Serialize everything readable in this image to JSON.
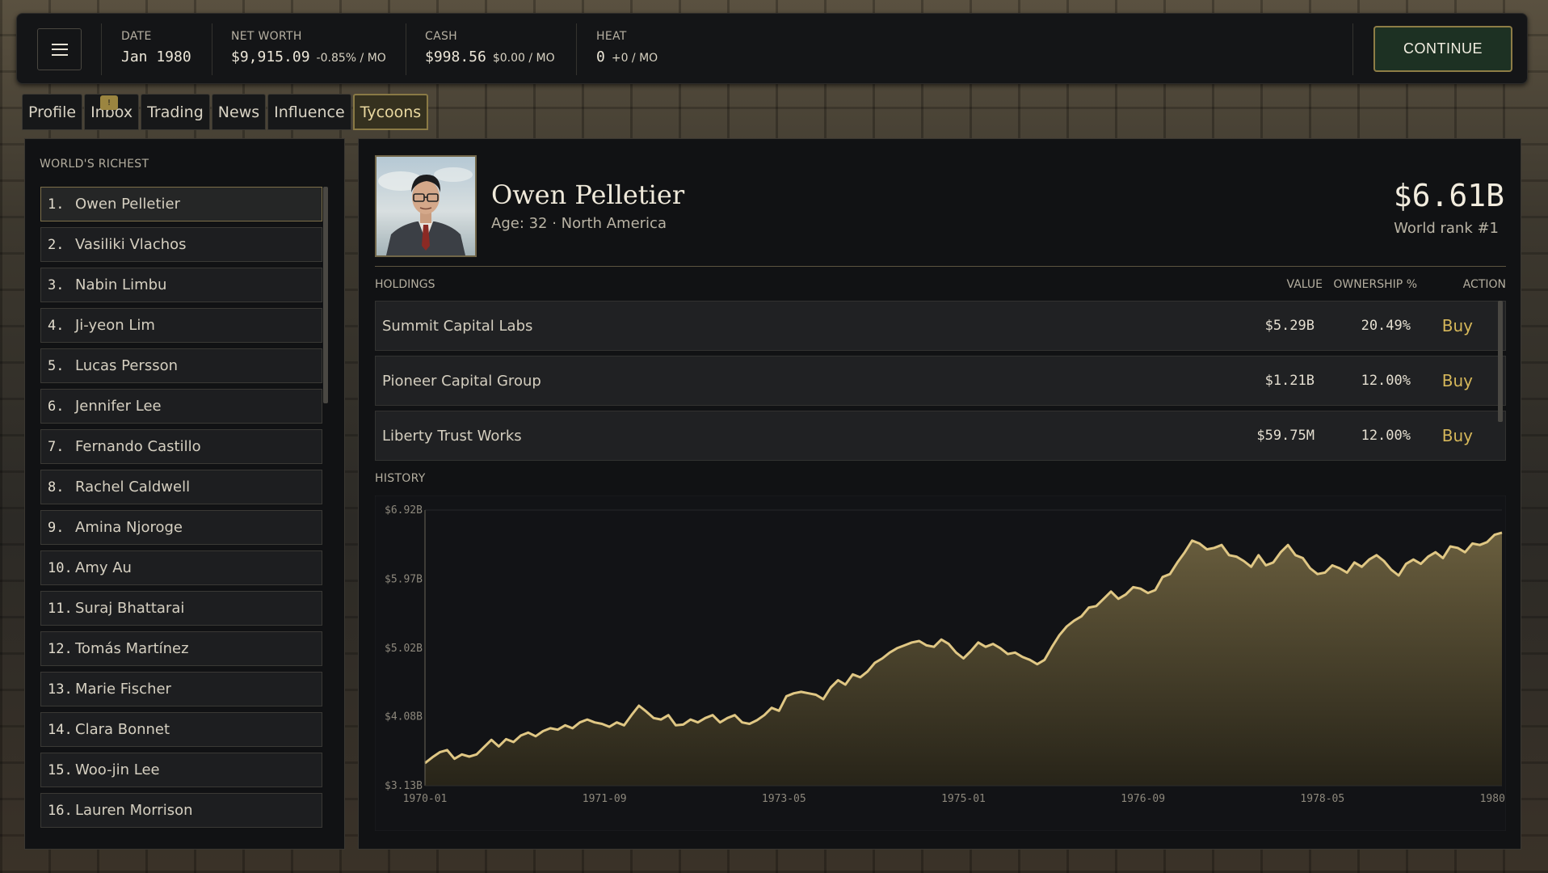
{
  "topbar": {
    "date": {
      "label": "DATE",
      "value": "Jan 1980"
    },
    "net_worth": {
      "label": "NET WORTH",
      "value": "$9,915.09",
      "delta": "-0.85% / MO"
    },
    "cash": {
      "label": "CASH",
      "value": "$998.56",
      "delta": "$0.00 / MO"
    },
    "heat": {
      "label": "HEAT",
      "value": "0",
      "delta": "+0 / MO"
    },
    "continue_label": "CONTINUE"
  },
  "tabs": [
    {
      "label": "Profile"
    },
    {
      "label": "Inbox"
    },
    {
      "label": "Trading"
    },
    {
      "label": "News"
    },
    {
      "label": "Influence"
    },
    {
      "label": "Tycoons"
    }
  ],
  "inbox_badge": "!",
  "richest": {
    "heading": "WORLD'S RICHEST",
    "items": [
      {
        "rank": "1.",
        "name": "Owen Pelletier"
      },
      {
        "rank": "2.",
        "name": "Vasiliki Vlachos"
      },
      {
        "rank": "3.",
        "name": "Nabin Limbu"
      },
      {
        "rank": "4.",
        "name": "Ji-yeon Lim"
      },
      {
        "rank": "5.",
        "name": "Lucas Persson"
      },
      {
        "rank": "6.",
        "name": "Jennifer Lee"
      },
      {
        "rank": "7.",
        "name": "Fernando Castillo"
      },
      {
        "rank": "8.",
        "name": "Rachel Caldwell"
      },
      {
        "rank": "9.",
        "name": "Amina Njoroge"
      },
      {
        "rank": "10.",
        "name": "Amy Au"
      },
      {
        "rank": "11.",
        "name": "Suraj Bhattarai"
      },
      {
        "rank": "12.",
        "name": "Tomás Martínez"
      },
      {
        "rank": "13.",
        "name": "Marie Fischer"
      },
      {
        "rank": "14.",
        "name": "Clara Bonnet"
      },
      {
        "rank": "15.",
        "name": "Woo-jin Lee"
      },
      {
        "rank": "16.",
        "name": "Lauren Morrison"
      }
    ]
  },
  "profile": {
    "name": "Owen Pelletier",
    "subtitle": "Age: 32 · North America",
    "net_worth": "$6.61B",
    "world_rank": "World rank #1"
  },
  "holdings": {
    "heading": "HOLDINGS",
    "col_value": "VALUE",
    "col_ownership": "OWNERSHIP %",
    "col_action": "ACTION",
    "rows": [
      {
        "name": "Summit Capital Labs",
        "value": "$5.29B",
        "ownership": "20.49%",
        "action": "Buy"
      },
      {
        "name": "Pioneer Capital Group",
        "value": "$1.21B",
        "ownership": "12.00%",
        "action": "Buy"
      },
      {
        "name": "Liberty Trust Works",
        "value": "$59.75M",
        "ownership": "12.00%",
        "action": "Buy"
      }
    ]
  },
  "history_heading": "HISTORY",
  "colors": {
    "accent_gold": "#d5b75a",
    "area_fill_top": "#6e6240",
    "line": "#e0c784",
    "continue_bg": "#1d3123"
  },
  "chart_data": {
    "type": "area",
    "title": "",
    "xlabel": "",
    "ylabel": "",
    "y_tick_labels": [
      "$6.92B",
      "$5.97B",
      "$5.02B",
      "$4.08B",
      "$3.13B"
    ],
    "y_ticks": [
      6.92,
      5.97,
      5.02,
      4.08,
      3.13
    ],
    "x_tick_labels": [
      "1970-01",
      "1971-09",
      "1973-05",
      "1975-01",
      "1976-09",
      "1978-05",
      "1980-01"
    ],
    "ylim": [
      3.13,
      6.92
    ],
    "grid": false,
    "series": [
      {
        "values": [
          3.44,
          3.52,
          3.59,
          3.62,
          3.5,
          3.56,
          3.53,
          3.56,
          3.66,
          3.76,
          3.67,
          3.77,
          3.73,
          3.82,
          3.86,
          3.81,
          3.88,
          3.92,
          3.9,
          3.96,
          3.92,
          4.0,
          4.04,
          4.0,
          3.98,
          3.94,
          4.0,
          3.96,
          4.1,
          4.23,
          4.15,
          4.06,
          4.04,
          4.1,
          3.96,
          3.97,
          4.04,
          4.0,
          4.06,
          4.1,
          4.0,
          4.06,
          4.1,
          4.0,
          3.98,
          4.03,
          4.1,
          4.2,
          4.16,
          4.36,
          4.4,
          4.42,
          4.4,
          4.38,
          4.32,
          4.48,
          4.58,
          4.52,
          4.66,
          4.62,
          4.7,
          4.82,
          4.88,
          4.96,
          5.02,
          5.06,
          5.1,
          5.12,
          5.06,
          5.04,
          5.14,
          5.08,
          4.96,
          4.88,
          4.98,
          5.1,
          5.04,
          5.08,
          5.02,
          4.94,
          4.96,
          4.9,
          4.86,
          4.8,
          4.86,
          5.04,
          5.2,
          5.32,
          5.4,
          5.46,
          5.58,
          5.6,
          5.7,
          5.8,
          5.7,
          5.76,
          5.86,
          5.84,
          5.78,
          5.82,
          6.0,
          6.04,
          6.2,
          6.34,
          6.5,
          6.46,
          6.38,
          6.4,
          6.44,
          6.3,
          6.28,
          6.22,
          6.14,
          6.3,
          6.16,
          6.2,
          6.34,
          6.44,
          6.3,
          6.26,
          6.12,
          6.04,
          6.06,
          6.16,
          6.12,
          6.06,
          6.2,
          6.14,
          6.24,
          6.3,
          6.22,
          6.1,
          6.02,
          6.18,
          6.24,
          6.18,
          6.28,
          6.34,
          6.26,
          6.42,
          6.4,
          6.34,
          6.46,
          6.44,
          6.48,
          6.58,
          6.61
        ]
      }
    ]
  }
}
